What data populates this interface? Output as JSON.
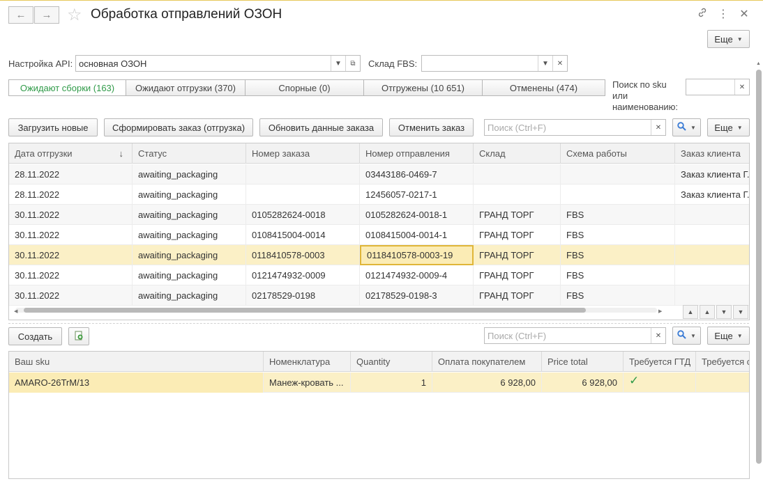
{
  "window": {
    "title": "Обработка отправлений ОЗОН"
  },
  "header": {
    "more_label": "Еще"
  },
  "filters": {
    "api_label": "Настройка API:",
    "api_value": "основная ОЗОН",
    "warehouse_label": "Склад FBS:",
    "warehouse_value": "",
    "search_sku_label": "Поиск по sku или наименованию:"
  },
  "tabs": [
    {
      "label": "Ожидают сборки (163)",
      "active": true
    },
    {
      "label": "Ожидают отгрузки (370)",
      "active": false
    },
    {
      "label": "Спорные (0)",
      "active": false
    },
    {
      "label": "Отгружены (10 651)",
      "active": false
    },
    {
      "label": "Отменены (474)",
      "active": false
    }
  ],
  "toolbar": {
    "load_new": "Загрузить новые",
    "form_order": "Сформировать заказ (отгрузка)",
    "update_order": "Обновить данные заказа",
    "cancel_order": "Отменить заказ",
    "search_placeholder": "Поиск (Ctrl+F)",
    "more_label": "Еще"
  },
  "orders_table": {
    "columns": [
      "Дата отгрузки",
      "Статус",
      "Номер заказа",
      "Номер отправления",
      "Склад",
      "Схема работы",
      "Заказ клиента"
    ],
    "rows": [
      [
        "28.11.2022",
        "awaiting_packaging",
        "",
        "03443186-0469-7",
        "",
        "",
        "Заказ клиента Г..."
      ],
      [
        "28.11.2022",
        "awaiting_packaging",
        "",
        "12456057-0217-1",
        "",
        "",
        "Заказ клиента Г..."
      ],
      [
        "30.11.2022",
        "awaiting_packaging",
        "0105282624-0018",
        "0105282624-0018-1",
        "ГРАНД ТОРГ",
        "FBS",
        ""
      ],
      [
        "30.11.2022",
        "awaiting_packaging",
        "0108415004-0014",
        "0108415004-0014-1",
        "ГРАНД ТОРГ",
        "FBS",
        ""
      ],
      [
        "30.11.2022",
        "awaiting_packaging",
        "0118410578-0003",
        "0118410578-0003-19",
        "ГРАНД ТОРГ",
        "FBS",
        ""
      ],
      [
        "30.11.2022",
        "awaiting_packaging",
        "0121474932-0009",
        "0121474932-0009-4",
        "ГРАНД ТОРГ",
        "FBS",
        ""
      ],
      [
        "30.11.2022",
        "awaiting_packaging",
        "02178529-0198",
        "02178529-0198-3",
        "ГРАНД ТОРГ",
        "FBS",
        ""
      ]
    ]
  },
  "items_toolbar": {
    "create_label": "Создать",
    "search_placeholder": "Поиск (Ctrl+F)",
    "more_label": "Еще"
  },
  "items_table": {
    "columns": [
      "Ваш sku",
      "Номенклатура",
      "Quantity",
      "Оплата покупателем",
      "Price total",
      "Требуется ГТД",
      "Требуется с"
    ],
    "rows": [
      [
        "AMARO-26TrM/13",
        "Манеж-кровать ...",
        "1",
        "6 928,00",
        "6 928,00",
        "✓",
        ""
      ]
    ]
  },
  "colors": {
    "active_tab": "#2f9a48",
    "selected_row": "#fbf0c6",
    "check": "#2f9a48"
  }
}
